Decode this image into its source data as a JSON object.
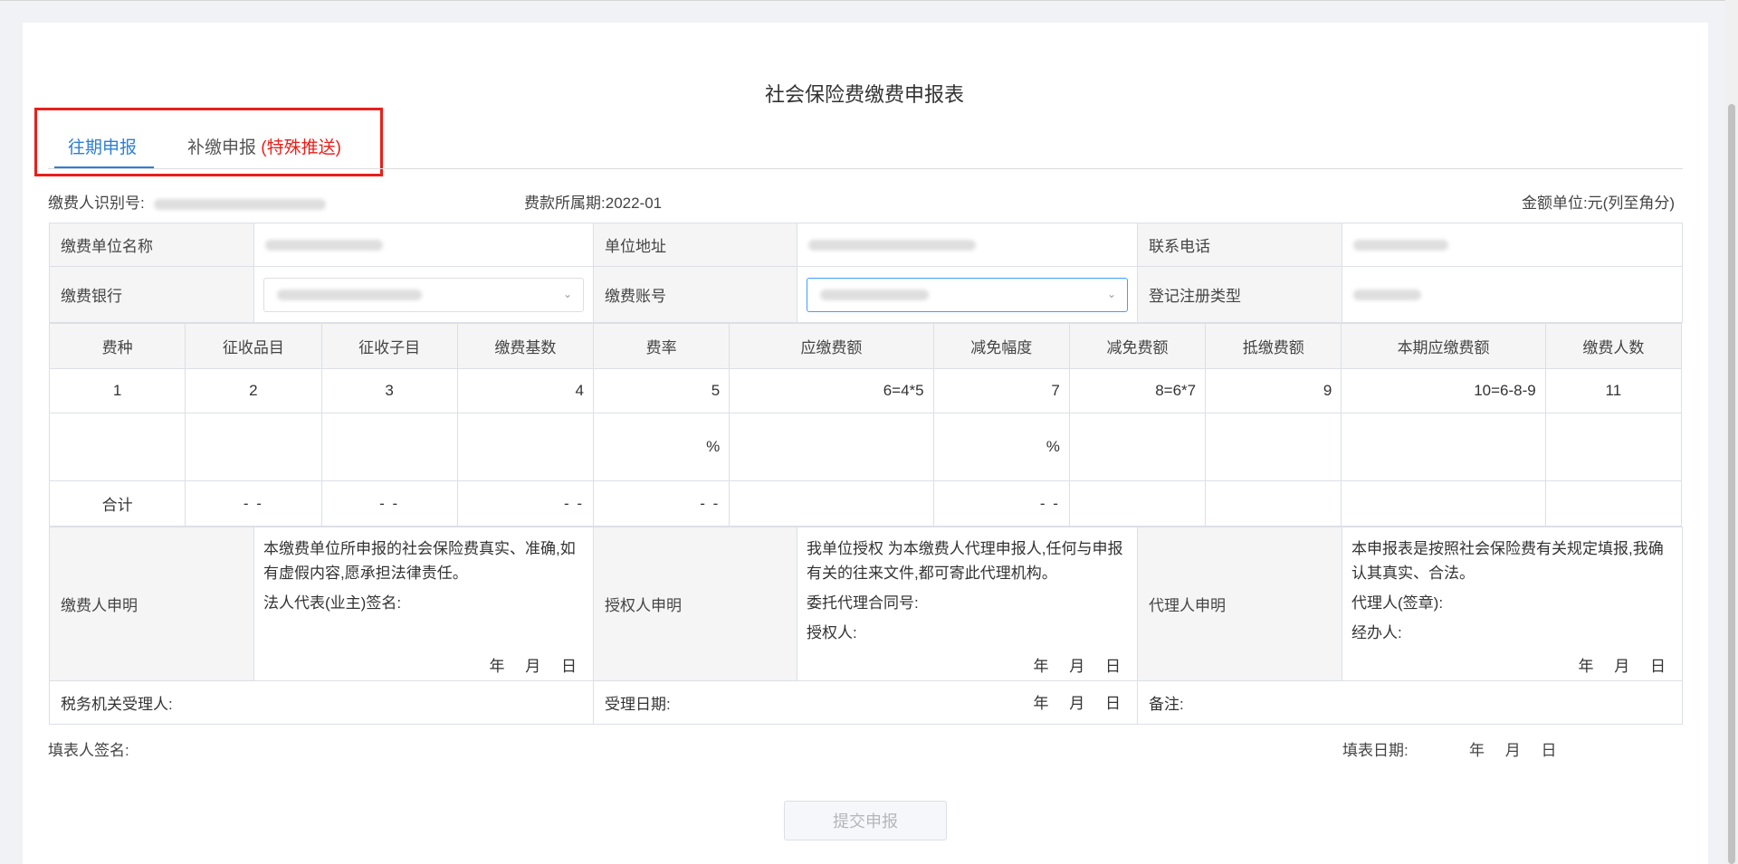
{
  "page_title": "社会保险费缴费申报表",
  "tabs": [
    {
      "label": "往期申报"
    },
    {
      "label": "补缴申报",
      "tag": "(特殊推送)"
    }
  ],
  "header": {
    "payer_id_label": "缴费人识别号:",
    "period_label": "费款所属期:",
    "period_value": "2022-01",
    "unit_label": "金额单位:元(列至角分)"
  },
  "info_rows": {
    "unit_name_label": "缴费单位名称",
    "address_label": "单位地址",
    "phone_label": "联系电话",
    "bank_label": "缴费银行",
    "account_label": "缴费账号",
    "reg_type_label": "登记注册类型"
  },
  "columns": [
    "费种",
    "征收品目",
    "征收子目",
    "缴费基数",
    "费率",
    "应缴费额",
    "减免幅度",
    "减免费额",
    "抵缴费额",
    "本期应缴费额",
    "缴费人数"
  ],
  "column_numbers": [
    "1",
    "2",
    "3",
    "4",
    "5",
    "6=4*5",
    "7",
    "8=6*7",
    "9",
    "10=6-8-9",
    "11"
  ],
  "percent_sign": "%",
  "total_row": {
    "label": "合计",
    "dash": "- -"
  },
  "declarations": {
    "payer_label": "缴费人申明",
    "payer_text": "本缴费单位所申报的社会保险费真实、准确,如有虚假内容,愿承担法律责任。",
    "payer_sign": "法人代表(业主)签名:",
    "authorizer_label": "授权人申明",
    "authorizer_text": "我单位授权 为本缴费人代理申报人,任何与申报有关的往来文件,都可寄此代理机构。",
    "contract_no": "委托代理合同号:",
    "authorizer": "授权人:",
    "agent_label": "代理人申明",
    "agent_text": "本申报表是按照社会保险费有关规定填报,我确认其真实、合法。",
    "agent_seal": "代理人(签章):",
    "handler": "经办人:",
    "date_ymd": "年 月 日"
  },
  "footer_row": {
    "tax_receiver": "税务机关受理人:",
    "accept_date": "受理日期:",
    "remark": "备注:"
  },
  "filler_sign": "填表人签名:",
  "fill_date": "填表日期:",
  "submit_label": "提交申报"
}
